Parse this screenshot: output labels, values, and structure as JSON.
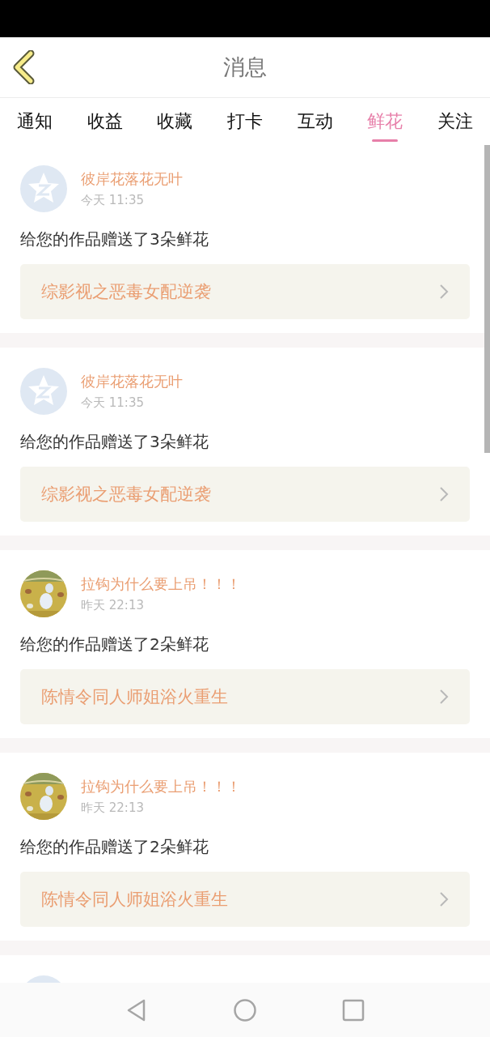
{
  "header": {
    "title": "消息"
  },
  "tabs": [
    {
      "label": "通知",
      "selected": false
    },
    {
      "label": "收益",
      "selected": false
    },
    {
      "label": "收藏",
      "selected": false
    },
    {
      "label": "打卡",
      "selected": false
    },
    {
      "label": "互动",
      "selected": false
    },
    {
      "label": "鲜花",
      "selected": true
    },
    {
      "label": "关注",
      "selected": false
    }
  ],
  "messages": [
    {
      "avatar": {
        "kind": "default"
      },
      "name": "彼岸花落花无叶",
      "time": "今天 11:35",
      "text": "给您的作品赠送了3朵鲜花",
      "work": "综影视之恶毒女配逆袭"
    },
    {
      "avatar": {
        "kind": "default"
      },
      "name": "彼岸花落花无叶",
      "time": "今天 11:35",
      "text": "给您的作品赠送了3朵鲜花",
      "work": "综影视之恶毒女配逆袭"
    },
    {
      "name": "拉钩为什么要上吊！！！",
      "time": "昨天 22:13",
      "text": "给您的作品赠送了2朵鲜花",
      "work": "陈情令同人师姐浴火重生"
    },
    {
      "name": "拉钩为什么要上吊！！！",
      "time": "昨天 22:13",
      "text": "给您的作品赠送了2朵鲜花",
      "work": "陈情令同人师姐浴火重生"
    },
    {
      "avatar": {
        "kind": "default"
      }
    }
  ]
}
